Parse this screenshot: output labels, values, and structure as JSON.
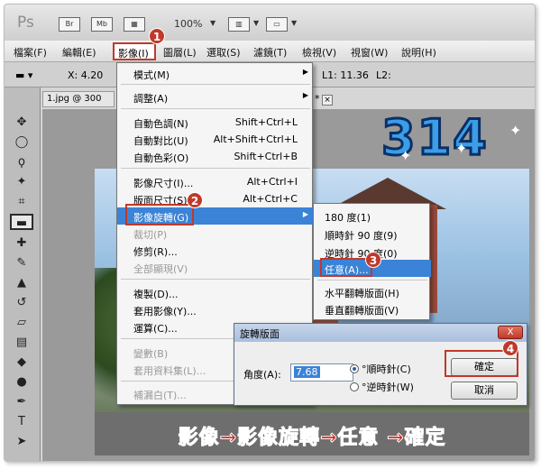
{
  "app": {
    "logo": "Ps",
    "tb_icons": [
      "Br",
      "Mb"
    ],
    "zoom": "100%"
  },
  "menubar": [
    "檔案(F)",
    "編輯(E)",
    "影像(I)",
    "圖層(L)",
    "選取(S)",
    "濾鏡(T)",
    "檢視(V)",
    "視窗(W)",
    "說明(H)"
  ],
  "optionsbar": {
    "x": "X: 4.20",
    "l1": "L1: 11.36",
    "l2": "L2:"
  },
  "document": {
    "tab_label": "1.jpg @ 300",
    "tab_tail": "*"
  },
  "image_menu": {
    "items": [
      {
        "label": "模式(M)",
        "shortcut": "",
        "submenu": true,
        "disabled": false
      },
      {
        "label": "調整(A)",
        "shortcut": "",
        "submenu": true,
        "disabled": false
      },
      {
        "label": "自動色調(N)",
        "shortcut": "Shift+Ctrl+L",
        "submenu": false,
        "disabled": false
      },
      {
        "label": "自動對比(U)",
        "shortcut": "Alt+Shift+Ctrl+L",
        "submenu": false,
        "disabled": false
      },
      {
        "label": "自動色彩(O)",
        "shortcut": "Shift+Ctrl+B",
        "submenu": false,
        "disabled": false
      },
      {
        "label": "影像尺寸(I)...",
        "shortcut": "Alt+Ctrl+I",
        "submenu": false,
        "disabled": false
      },
      {
        "label": "版面尺寸(S)...",
        "shortcut": "Alt+Ctrl+C",
        "submenu": false,
        "disabled": false
      },
      {
        "label": "影像旋轉(G)",
        "shortcut": "",
        "submenu": true,
        "disabled": false,
        "highlighted": true
      },
      {
        "label": "裁切(P)",
        "shortcut": "",
        "submenu": false,
        "disabled": true
      },
      {
        "label": "修剪(R)...",
        "shortcut": "",
        "submenu": false,
        "disabled": false
      },
      {
        "label": "全部顯現(V)",
        "shortcut": "",
        "submenu": false,
        "disabled": true
      },
      {
        "label": "複製(D)...",
        "shortcut": "",
        "submenu": false,
        "disabled": false
      },
      {
        "label": "套用影像(Y)...",
        "shortcut": "",
        "submenu": false,
        "disabled": false
      },
      {
        "label": "運算(C)...",
        "shortcut": "",
        "submenu": false,
        "disabled": false
      },
      {
        "label": "變數(B)",
        "shortcut": "",
        "submenu": true,
        "disabled": true
      },
      {
        "label": "套用資料集(L)...",
        "shortcut": "",
        "submenu": false,
        "disabled": true
      },
      {
        "label": "補漏白(T)...",
        "shortcut": "",
        "submenu": false,
        "disabled": true
      }
    ]
  },
  "rotate_submenu": {
    "items": [
      {
        "label": "180 度(1)"
      },
      {
        "label": "順時針 90 度(9)"
      },
      {
        "label": "逆時針 90 度(0)"
      },
      {
        "label": "任意(A)...",
        "highlighted": true
      },
      {
        "label": "水平翻轉版面(H)"
      },
      {
        "label": "垂直翻轉版面(V)"
      }
    ]
  },
  "dialog": {
    "title": "旋轉版面",
    "close": "X",
    "angle_label": "角度(A):",
    "angle_value": "7.68",
    "cw_label": "°順時針(C)",
    "ccw_label": "°逆時針(W)",
    "ok_label": "確定",
    "cancel_label": "取消"
  },
  "badges": [
    "1",
    "2",
    "3",
    "4"
  ],
  "logo_text": "314",
  "caption": "影像→影像旋轉→任意 →確定",
  "colors": {
    "highlight": "#3b83d6",
    "annotation_red": "#c0392b",
    "logo_blue": "#3a9ee8"
  }
}
